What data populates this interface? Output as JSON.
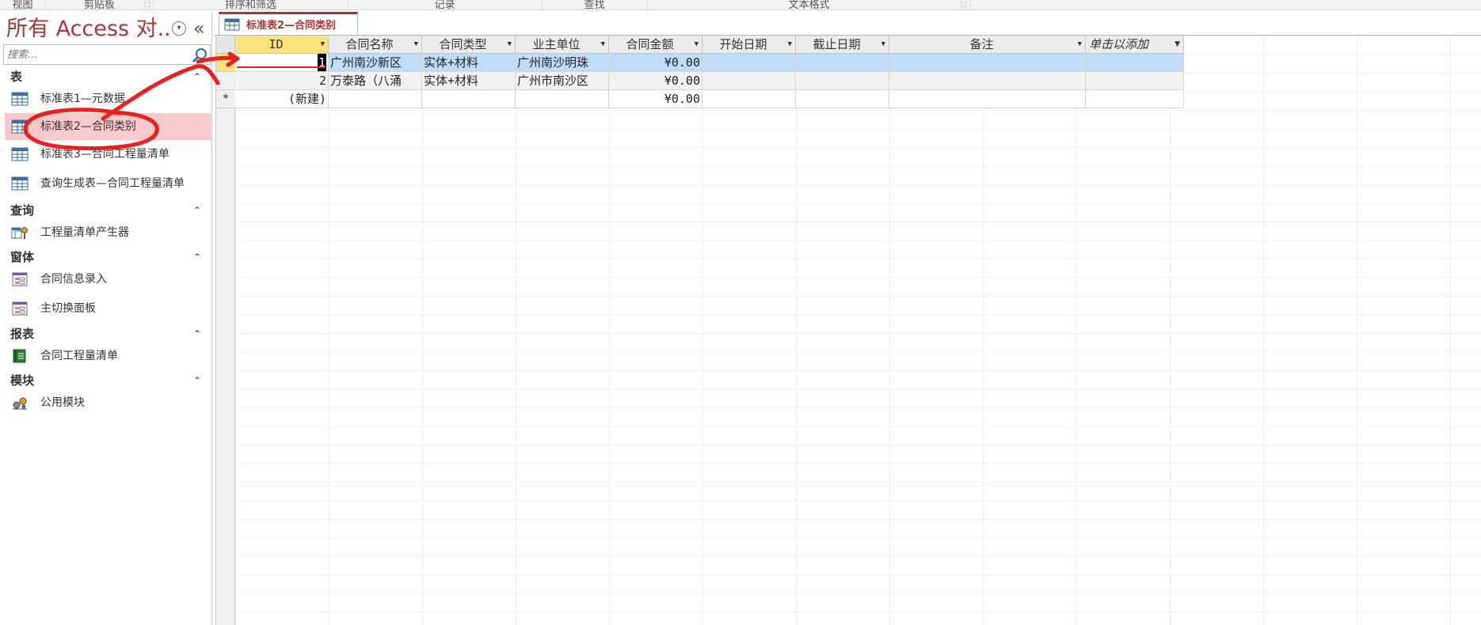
{
  "ribbon": {
    "groups": [
      "视图",
      "剪贴板",
      "排序和筛选",
      "记录",
      "查找",
      "文本格式"
    ]
  },
  "nav": {
    "title": "所有 Access 对...",
    "collapse_glyph": "«",
    "search": {
      "placeholder": "搜索...",
      "value": ""
    },
    "groups": [
      {
        "label": "表",
        "items": [
          "标准表1—元数据",
          "标准表2—合同类别",
          "标准表3—合同工程量清单",
          "查询生成表—合同工程量清单"
        ]
      },
      {
        "label": "查询",
        "items": [
          "工程量清单产生器"
        ]
      },
      {
        "label": "窗体",
        "items": [
          "合同信息录入",
          "主切换面板"
        ]
      },
      {
        "label": "报表",
        "items": [
          "合同工程量清单"
        ]
      },
      {
        "label": "模块",
        "items": [
          "公用模块"
        ]
      }
    ],
    "selected_item": "标准表2—合同类别",
    "icons": {
      "table": "table-icon",
      "query": "query-icon",
      "form": "form-icon",
      "report": "report-icon",
      "module": "module-icon"
    }
  },
  "document_tab": {
    "label": "标准表2—合同类别"
  },
  "datasheet": {
    "columns": [
      "ID",
      "合同名称",
      "合同类型",
      "业主单位",
      "合同金额",
      "开始日期",
      "截止日期",
      "备注",
      "单击以添加"
    ],
    "rows": [
      [
        "1",
        "广州南沙新区",
        "实体+材料",
        "广州南沙明珠",
        "¥0.00",
        "",
        "",
        "",
        ""
      ],
      [
        "2",
        "万泰路（八涌",
        "实体+材料",
        "广州市南沙区",
        "¥0.00",
        "",
        "",
        "",
        ""
      ]
    ],
    "new_row": {
      "marker": "*",
      "id_placeholder": "(新建)",
      "amount": "¥0.00"
    }
  },
  "colors": {
    "accent": "#a4373a",
    "selected_nav": "#f8c9cb",
    "selected_row": "#bfdcf8",
    "active_header": "#fbe27a",
    "annotation": "#e8201e"
  }
}
